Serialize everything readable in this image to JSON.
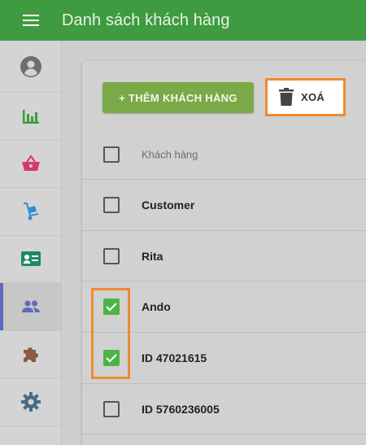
{
  "app": {
    "title": "Danh sách khách hàng"
  },
  "sidebar": {
    "items": [
      {
        "icon": "profile-icon",
        "color": "#6e6e6e"
      },
      {
        "icon": "bar-chart-icon",
        "color": "#3f9b3f"
      },
      {
        "icon": "basket-icon",
        "color": "#d63a6a"
      },
      {
        "icon": "hand-truck-icon",
        "color": "#2f8fd3"
      },
      {
        "icon": "contact-card-icon",
        "color": "#1f8a5e"
      },
      {
        "icon": "people-icon",
        "color": "#5c6bc0",
        "active": true
      },
      {
        "icon": "puzzle-icon",
        "color": "#8a5a44"
      },
      {
        "icon": "gear-icon",
        "color": "#456d8a"
      }
    ]
  },
  "toolbar": {
    "add_label": "+ THÊM KHÁCH HÀNG",
    "delete_label": "XOÁ"
  },
  "table": {
    "column_header": "Khách hàng",
    "rows": [
      {
        "name": "Customer",
        "checked": false
      },
      {
        "name": "Rita",
        "checked": false
      },
      {
        "name": "Ando",
        "checked": true
      },
      {
        "name": "ID 47021615",
        "checked": true
      },
      {
        "name": "ID 5760236005",
        "checked": false
      }
    ]
  },
  "colors": {
    "topbar": "#3f9b3f",
    "add_button": "#7aaa47",
    "checkbox_checked": "#4bb543",
    "highlight": "#f08a2c"
  }
}
